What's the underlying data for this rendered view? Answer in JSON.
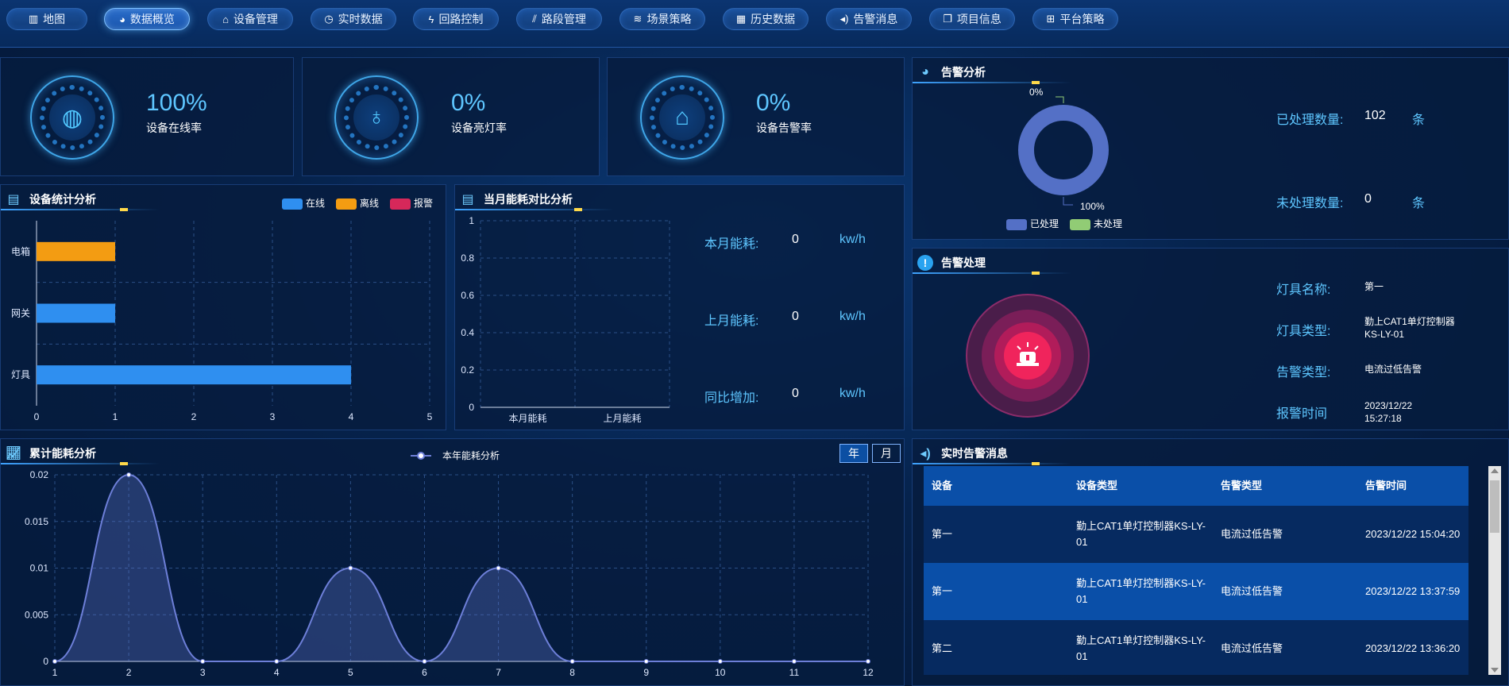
{
  "nav": [
    {
      "label": "地图",
      "icon": "map-icon"
    },
    {
      "label": "数据概览",
      "icon": "pie-chart-icon",
      "active": true
    },
    {
      "label": "设备管理",
      "icon": "router-icon"
    },
    {
      "label": "实时数据",
      "icon": "clock-icon"
    },
    {
      "label": "回路控制",
      "icon": "bolt-icon"
    },
    {
      "label": "路段管理",
      "icon": "road-icon"
    },
    {
      "label": "场景策略",
      "icon": "layers-icon"
    },
    {
      "label": "历史数据",
      "icon": "table-icon"
    },
    {
      "label": "告警消息",
      "icon": "speaker-icon"
    },
    {
      "label": "项目信息",
      "icon": "copy-icon"
    },
    {
      "label": "平台策略",
      "icon": "sitemap-icon"
    }
  ],
  "kpis": [
    {
      "value": "100%",
      "label": "设备在线率",
      "icon": "globe-icon"
    },
    {
      "value": "0%",
      "label": "设备亮灯率",
      "icon": "bulb-icon"
    },
    {
      "value": "0%",
      "label": "设备告警率",
      "icon": "siren-icon"
    }
  ],
  "alarm_analysis": {
    "title": "告警分析",
    "donut_label_top": "0%",
    "donut_label_bottom": "100%",
    "legend": [
      "已处理",
      "未处理"
    ],
    "processed_label": "已处理数量:",
    "processed_value": "102",
    "processed_unit": "条",
    "unprocessed_label": "未处理数量:",
    "unprocessed_value": "0",
    "unprocessed_unit": "条",
    "colors": {
      "processed": "#5470c6",
      "unprocessed": "#91cc75"
    }
  },
  "device_stats": {
    "title": "设备统计分析",
    "legend": [
      {
        "name": "在线",
        "color": "#2f8ff0"
      },
      {
        "name": "离线",
        "color": "#f39c12"
      },
      {
        "name": "报警",
        "color": "#d6285a"
      }
    ]
  },
  "monthly_energy": {
    "title": "当月能耗对比分析",
    "rows": [
      {
        "label": "本月能耗:",
        "value": "0",
        "unit": "kw/h"
      },
      {
        "label": "上月能耗:",
        "value": "0",
        "unit": "kw/h"
      },
      {
        "label": "同比增加:",
        "value": "0",
        "unit": "kw/h"
      }
    ]
  },
  "alarm_handle": {
    "title": "告警处理",
    "fields": [
      {
        "label": "灯具名称:",
        "value": "第一"
      },
      {
        "label": "灯具类型:",
        "value": "勤上CAT1单灯控制器KS-LY-01"
      },
      {
        "label": "告警类型:",
        "value": "电流过低告警"
      },
      {
        "label": "报警时间",
        "value": "2023/12/22 15:27:18"
      }
    ]
  },
  "cumulative": {
    "title": "累计能耗分析",
    "legend": "本年能耗分析",
    "btn_year": "年",
    "btn_month": "月"
  },
  "realtime_alarms": {
    "title": "实时告警消息",
    "headers": [
      "设备",
      "设备类型",
      "告警类型",
      "告警时间"
    ],
    "rows": [
      [
        "第一",
        "勤上CAT1单灯控制器KS-LY-01",
        "电流过低告警",
        "2023/12/22 15:04:20"
      ],
      [
        "第一",
        "勤上CAT1单灯控制器KS-LY-01",
        "电流过低告警",
        "2023/12/22 13:37:59"
      ],
      [
        "第二",
        "勤上CAT1单灯控制器KS-LY-01",
        "电流过低告警",
        "2023/12/22 13:36:20"
      ]
    ]
  },
  "chart_data": [
    {
      "type": "bar",
      "orientation": "horizontal",
      "categories": [
        "电箱",
        "网关",
        "灯具"
      ],
      "series": [
        {
          "name": "在线",
          "values": [
            0,
            1,
            4
          ],
          "color": "#2f8ff0"
        },
        {
          "name": "离线",
          "values": [
            1,
            0,
            0
          ],
          "color": "#f39c12"
        },
        {
          "name": "报警",
          "values": [
            0,
            0,
            0
          ],
          "color": "#d6285a"
        }
      ],
      "xlim": [
        0,
        5
      ],
      "xticks": [
        "0",
        "1",
        "2",
        "3",
        "4",
        "5"
      ],
      "grid": true,
      "legend": "top-right"
    },
    {
      "type": "bar",
      "categories": [
        "本月能耗",
        "上月能耗"
      ],
      "values": [
        0,
        0
      ],
      "ylim": [
        0,
        1
      ],
      "yticks": [
        "0",
        "0.2",
        "0.4",
        "0.6",
        "0.8",
        "1"
      ],
      "grid": true
    },
    {
      "type": "pie",
      "style": "donut",
      "slices": [
        {
          "name": "已处理",
          "value": 102,
          "label": "100%"
        },
        {
          "name": "未处理",
          "value": 0,
          "label": "0%"
        }
      ],
      "legend": "bottom"
    },
    {
      "type": "area",
      "x": [
        1,
        2,
        3,
        4,
        5,
        6,
        7,
        8,
        9,
        10,
        11,
        12
      ],
      "series": [
        {
          "name": "本年能耗分析",
          "values": [
            0,
            0.02,
            0,
            0,
            0.01,
            0,
            0.01,
            0,
            0,
            0,
            0,
            0
          ],
          "color": "#6d7fd8"
        }
      ],
      "ylim": [
        0,
        0.02
      ],
      "yticks": [
        "0",
        "0.005",
        "0.01",
        "0.015",
        "0.02"
      ],
      "grid": true,
      "legend": "top"
    }
  ]
}
